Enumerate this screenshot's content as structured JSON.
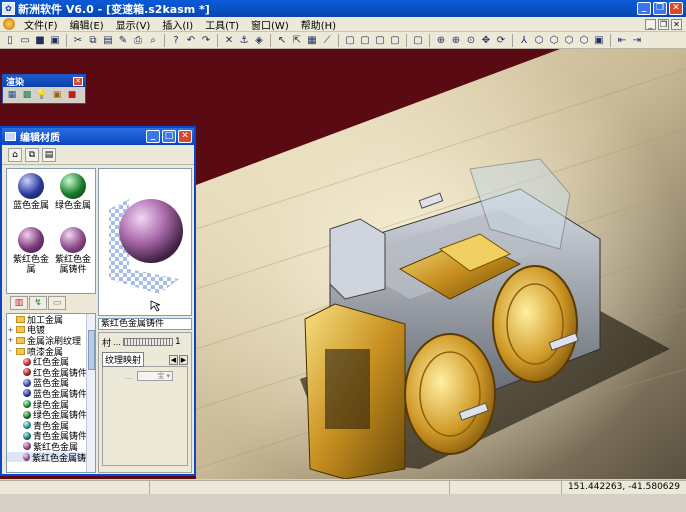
{
  "window": {
    "title": "新洲软件 V6.0 - [变速箱.s2kasm *]"
  },
  "menu": {
    "items": [
      "文件(F)",
      "编辑(E)",
      "显示(V)",
      "插入(I)",
      "工具(T)",
      "窗口(W)",
      "帮助(H)"
    ]
  },
  "material_editor": {
    "title": "编辑材质",
    "swatches": [
      {
        "label": "蓝色金属",
        "color": "#2a3a9a"
      },
      {
        "label": "绿色金属",
        "color": "#1a7a2a"
      },
      {
        "label": "紫红色金属",
        "color": "#7a3a78"
      },
      {
        "label": "紫红色金属铸件",
        "color": "#8a4a88"
      }
    ],
    "tree": [
      {
        "label": "加工金属",
        "type": "folder",
        "expander": ""
      },
      {
        "label": "电镀",
        "type": "folder",
        "expander": "+"
      },
      {
        "label": "金属涂刷纹理",
        "type": "folder",
        "expander": "+"
      },
      {
        "label": "喷漆金属",
        "type": "folder",
        "expander": "-"
      },
      {
        "label": "红色金属",
        "type": "ball",
        "color": "#b02020"
      },
      {
        "label": "红色金属铸件",
        "type": "ball",
        "color": "#902020"
      },
      {
        "label": "蓝色金属",
        "type": "ball",
        "color": "#2a3a9a"
      },
      {
        "label": "蓝色金属铸件",
        "type": "ball",
        "color": "#203080"
      },
      {
        "label": "绿色金属",
        "type": "ball",
        "color": "#1a7a2a"
      },
      {
        "label": "绿色金属铸件",
        "type": "ball",
        "color": "#186020"
      },
      {
        "label": "青色金属",
        "type": "ball",
        "color": "#208080"
      },
      {
        "label": "青色金属铸件",
        "type": "ball",
        "color": "#186868"
      },
      {
        "label": "紫红色金属",
        "type": "ball",
        "color": "#7a3a78"
      },
      {
        "label": "紫红色金属铸件",
        "type": "ball",
        "color": "#8a4a88"
      }
    ],
    "material_name": "紫红色金属铸件",
    "param_label": "村",
    "param_value": "1",
    "texture_tab": "纹理映射",
    "texture_dropdown": "宝"
  },
  "status": {
    "coords": "151.442263, -41.580629"
  }
}
